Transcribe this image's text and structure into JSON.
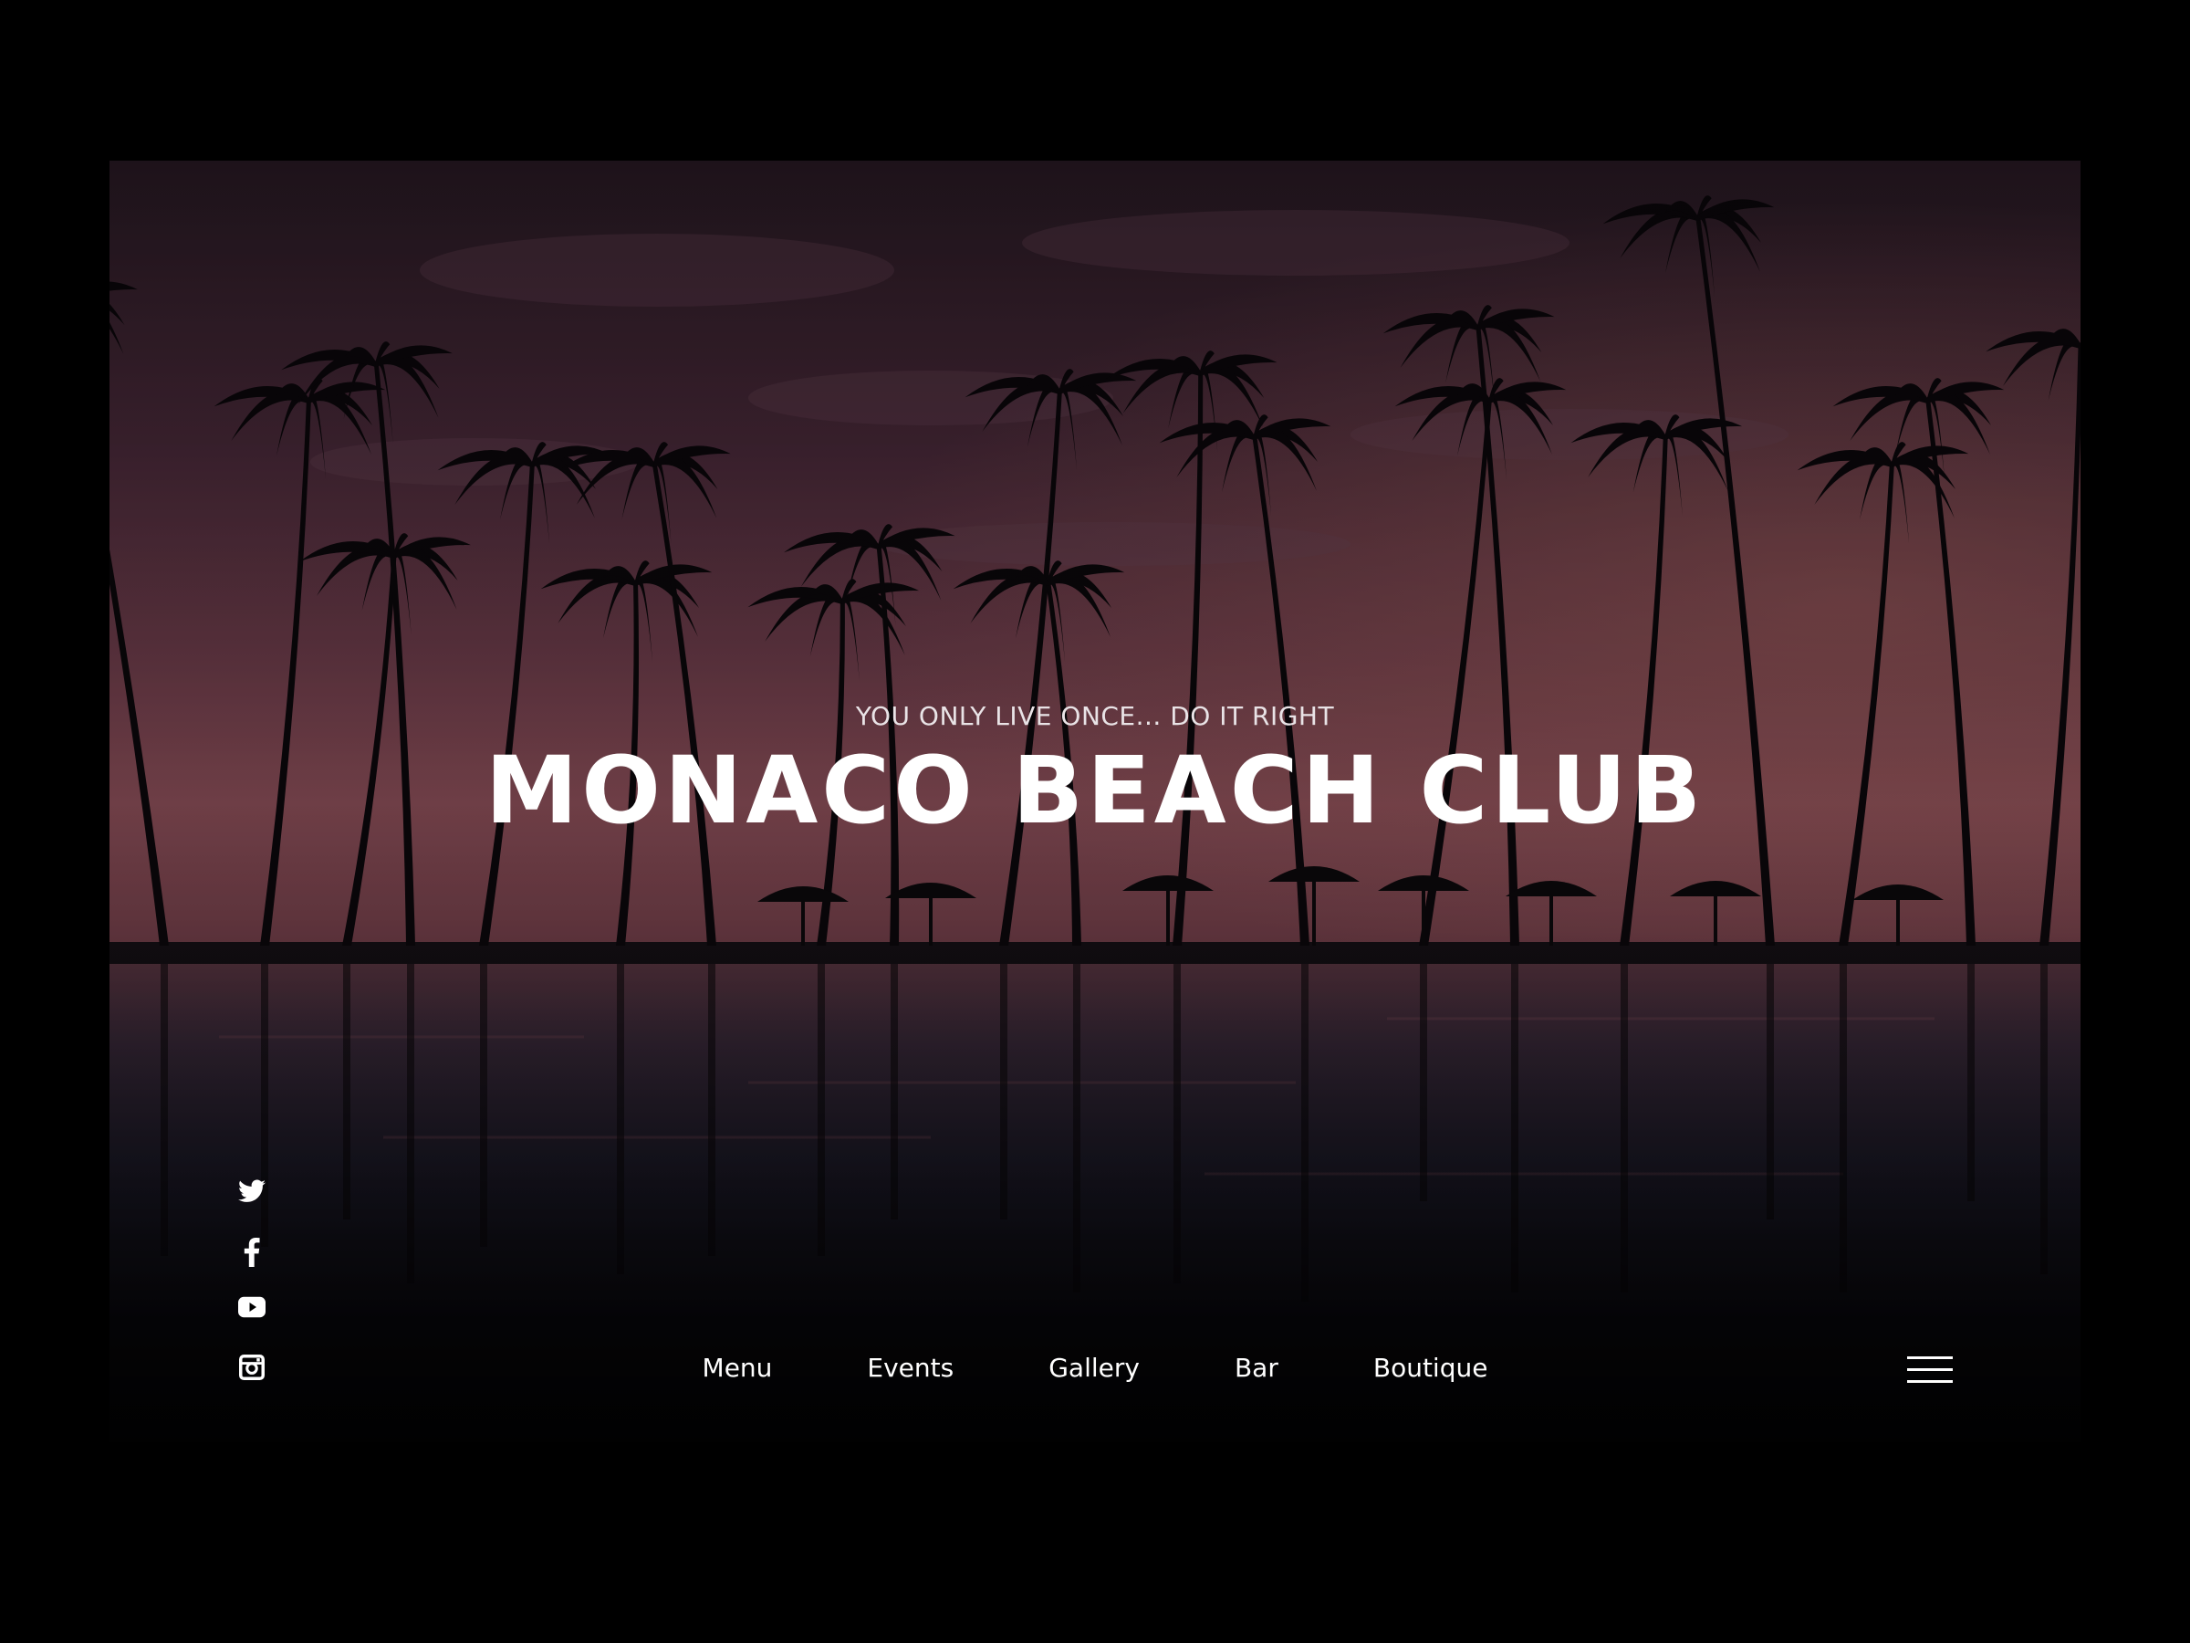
{
  "hero": {
    "tagline": "YOU ONLY LIVE ONCE... DO IT RIGHT",
    "title": "MONACO BEACH CLUB"
  },
  "social": [
    {
      "name": "twitter-icon"
    },
    {
      "name": "facebook-icon"
    },
    {
      "name": "youtube-icon"
    },
    {
      "name": "instagram-icon"
    }
  ],
  "nav": {
    "items": [
      {
        "label": "Menu"
      },
      {
        "label": "Events"
      },
      {
        "label": "Gallery"
      },
      {
        "label": "Bar"
      },
      {
        "label": "Boutique"
      }
    ],
    "menu_icon": "hamburger-menu-icon"
  },
  "colors": {
    "sky_top": "#2a1b26",
    "sky_mid": "#5b3444",
    "horizon": "#8a4e58",
    "water": "#1b1822",
    "text": "#ffffff"
  }
}
